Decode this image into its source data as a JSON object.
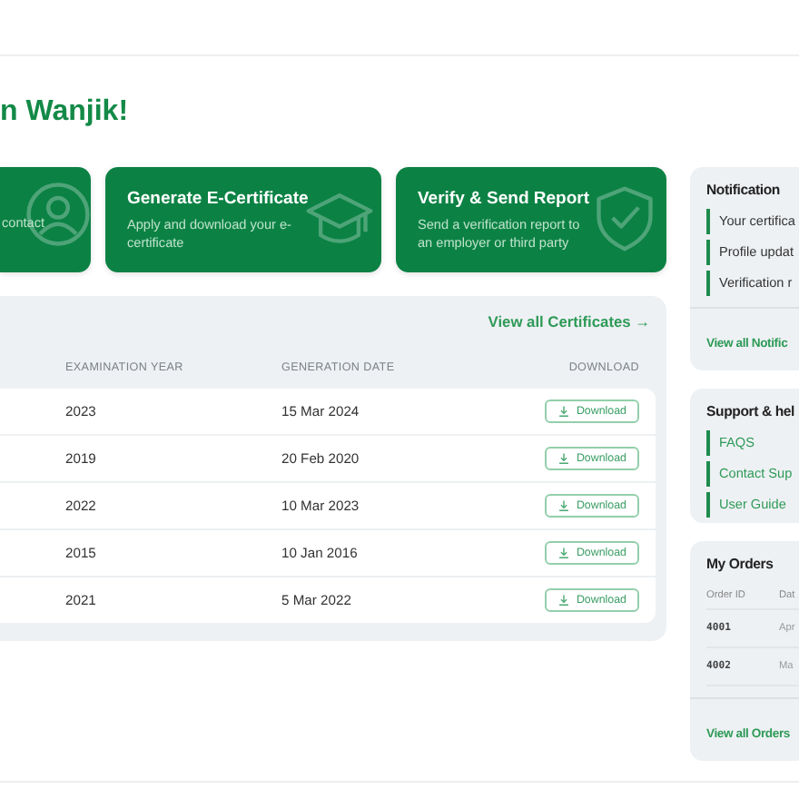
{
  "greeting": "n Wanjik!",
  "cards": [
    {
      "description": "contact"
    },
    {
      "title": "Generate E-Certificate",
      "description": "Apply and download your e-certificate"
    },
    {
      "title": "Verify & Send Report",
      "description": "Send a verification report to an employer or third party"
    }
  ],
  "certificates": {
    "link": "View all Certificates →",
    "columns": [
      "EXAMINATION YEAR",
      "GENERATION DATE",
      "DOWNLOAD"
    ],
    "rows": [
      {
        "year": "2023",
        "date": "15 Mar 2024",
        "action": "Download"
      },
      {
        "year": "2019",
        "date": "20 Feb 2020",
        "action": "Download"
      },
      {
        "year": "2022",
        "date": "10 Mar 2023",
        "action": "Download"
      },
      {
        "year": "2015",
        "date": "10 Jan 2016",
        "action": "Download"
      },
      {
        "year": "2021",
        "date": "5 Mar 2022",
        "action": "Download"
      }
    ]
  },
  "notification": {
    "title": "Notification",
    "items": [
      "Your certifica",
      "Profile updat",
      "Verification r"
    ],
    "link": "View all Notific"
  },
  "support": {
    "title": "Support & hel",
    "items": [
      "FAQS",
      "Contact Sup",
      "User Guide"
    ]
  },
  "orders": {
    "title": "My Orders",
    "columns": [
      "Order ID",
      "Dat"
    ],
    "rows": [
      {
        "id": "4001",
        "date": "Apr"
      },
      {
        "id": "4002",
        "date": "Ma"
      }
    ],
    "link": "View all Orders"
  }
}
